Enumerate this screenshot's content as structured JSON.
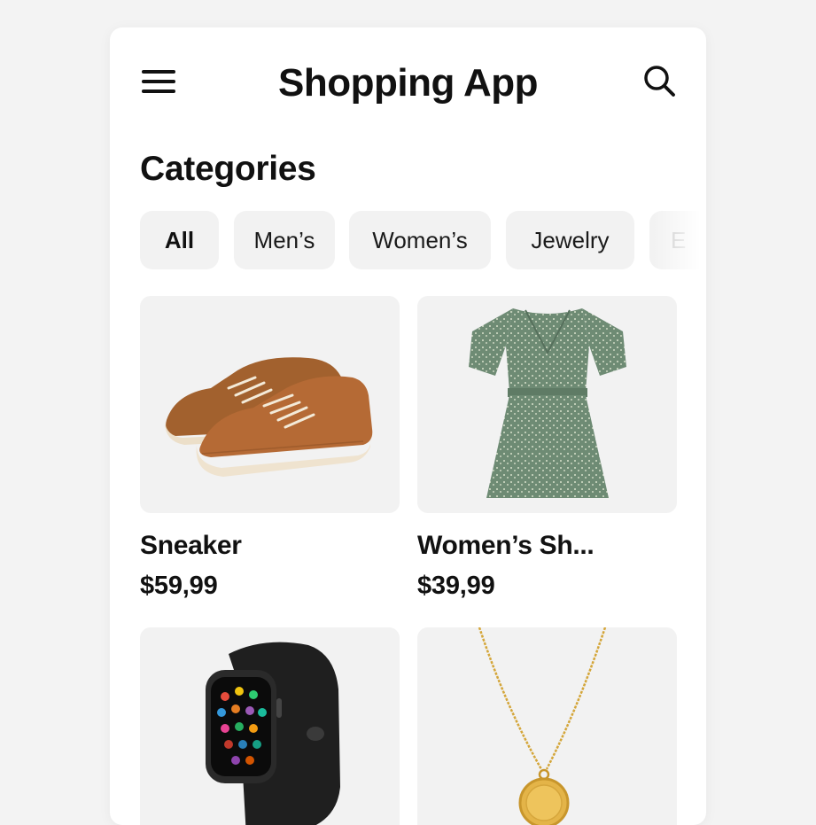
{
  "header": {
    "title": "Shopping App",
    "menu_icon": "hamburger-menu-icon",
    "search_icon": "search-icon"
  },
  "categories": {
    "title": "Categories",
    "chips": [
      {
        "label": "All",
        "active": true
      },
      {
        "label": "Men’s",
        "active": false
      },
      {
        "label": "Women’s",
        "active": false
      },
      {
        "label": "Jewelry",
        "active": false
      },
      {
        "label": "E",
        "active": false
      }
    ]
  },
  "products": [
    {
      "name": "Sneaker",
      "price": "$59,99",
      "image": "brown-sneaker"
    },
    {
      "name": "Women’s Sh...",
      "price": "$39,99",
      "image": "green-floral-dress"
    },
    {
      "name": "",
      "price": "",
      "image": "black-smartwatch"
    },
    {
      "name": "",
      "price": "",
      "image": "gold-pendant-necklace"
    }
  ],
  "colors": {
    "background": "#f3f3f3",
    "surface": "#ffffff",
    "chip_background": "#f2f2f2",
    "text": "#111111"
  }
}
